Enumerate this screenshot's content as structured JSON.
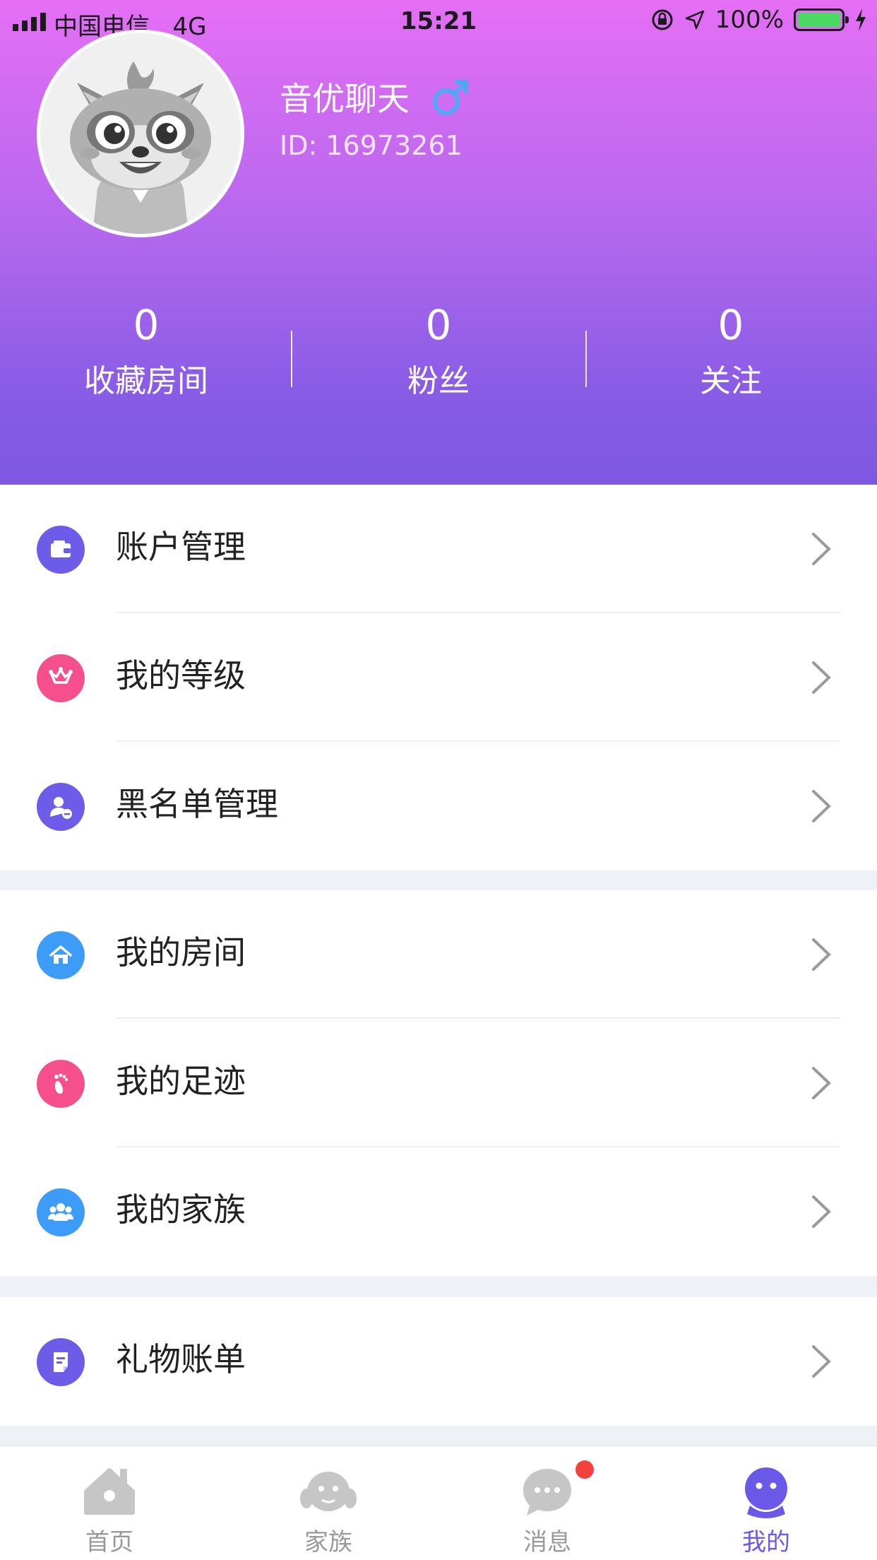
{
  "status_bar": {
    "carrier": "中国电信",
    "network": "4G",
    "time": "15:21",
    "battery": "100%"
  },
  "profile": {
    "name": "音优聊天",
    "id": "ID: 16973261",
    "gender_icon": "male-icon"
  },
  "stats": [
    {
      "value": "0",
      "label": "收藏房间"
    },
    {
      "value": "0",
      "label": "粉丝"
    },
    {
      "value": "0",
      "label": "关注"
    }
  ],
  "menu": {
    "group1": [
      {
        "label": "账户管理",
        "icon": "wallet-icon",
        "color": "#6c5ce7"
      },
      {
        "label": "我的等级",
        "icon": "crown-icon",
        "color": "#f5508c"
      },
      {
        "label": "黑名单管理",
        "icon": "block-user-icon",
        "color": "#6c5ce7"
      }
    ],
    "group2": [
      {
        "label": "我的房间",
        "icon": "home-icon",
        "color": "#3d9cf7"
      },
      {
        "label": "我的足迹",
        "icon": "footprint-icon",
        "color": "#f5508c"
      },
      {
        "label": "我的家族",
        "icon": "family-icon",
        "color": "#3d9cf7"
      }
    ],
    "group3": [
      {
        "label": "礼物账单",
        "icon": "bill-icon",
        "color": "#6c5ce7"
      }
    ]
  },
  "tabs": [
    {
      "label": "首页",
      "icon": "home-tab-icon"
    },
    {
      "label": "家族",
      "icon": "family-tab-icon"
    },
    {
      "label": "消息",
      "icon": "message-tab-icon"
    },
    {
      "label": "我的",
      "icon": "me-tab-icon",
      "active": true
    }
  ],
  "colors": {
    "gradient_top": "#e56ff5",
    "gradient_bottom": "#7d58e2",
    "accent": "#6a58e8",
    "badge": "#f5413c"
  }
}
